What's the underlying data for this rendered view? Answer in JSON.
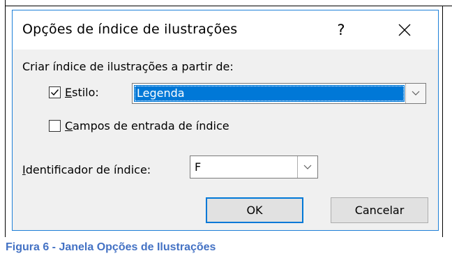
{
  "dialog": {
    "title": "Opções de índice de ilustrações",
    "help_label": "?",
    "group_label": "Criar índice de ilustrações a partir de:",
    "style_option": {
      "checked": true,
      "label_mnemonic": "E",
      "label_rest": "stilo:",
      "selected_value": "Legenda"
    },
    "fields_option": {
      "checked": false,
      "label_mnemonic": "C",
      "label_rest": "ampos de entrada de índice"
    },
    "identifier": {
      "label_mnemonic": "I",
      "label_rest": "dentificador de índice:",
      "selected_value": "F"
    },
    "ok_label": "OK",
    "cancel_label": "Cancelar"
  },
  "caption": "Figura 6 - Janela Opções de Ilustrações",
  "colors": {
    "accent": "#0078d7",
    "selection": "#0078d7",
    "caption": "#4472c4"
  },
  "icons": [
    "close-icon",
    "chevron-down-icon",
    "checkmark-icon",
    "help-icon"
  ]
}
